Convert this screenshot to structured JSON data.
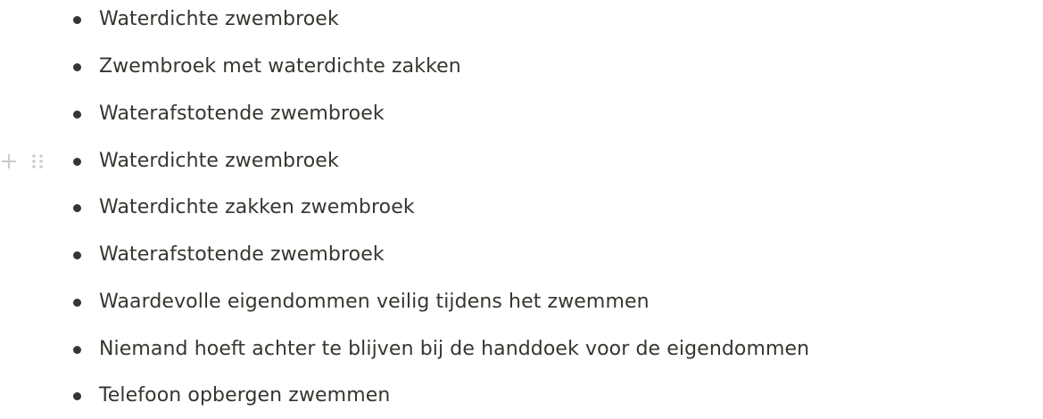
{
  "list": {
    "items": [
      {
        "text": "Waterdichte zwembroek"
      },
      {
        "text": "Zwembroek met waterdichte zakken"
      },
      {
        "text": "Waterafstotende zwembroek"
      },
      {
        "text": "Waterdichte zwembroek"
      },
      {
        "text": "Waterdichte zakken zwembroek"
      },
      {
        "text": "Waterafstotende zwembroek"
      },
      {
        "text": "Waardevolle eigendommen veilig tijdens het zwemmen"
      },
      {
        "text": "Niemand hoeft achter te blijven bij de handdoek voor de eigendommen"
      },
      {
        "text": "Telefoon opbergen zwemmen"
      }
    ]
  },
  "block_controls": {
    "add_icon": "plus-icon",
    "drag_icon": "drag-handle-icon"
  },
  "colors": {
    "text": "#37352f",
    "bullet": "#37352f",
    "controls": "#d6d5d2",
    "background": "#ffffff"
  }
}
